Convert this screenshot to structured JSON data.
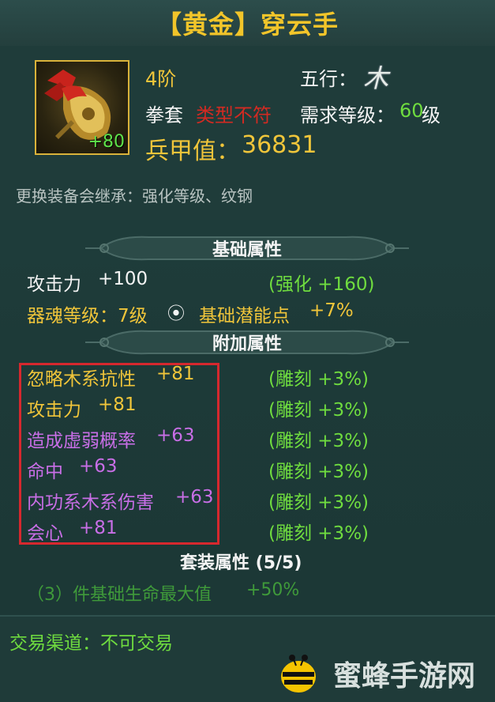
{
  "title": "【黄金】穿云手",
  "item": {
    "enhance_badge": "+80",
    "tier": "4阶",
    "five_element_label": "五行：",
    "five_element_glyph": "木",
    "type": "拳套",
    "type_mismatch": "类型不符",
    "level_label": "需求等级：",
    "level_value": "60",
    "level_unit": "级",
    "power_label": "兵甲值：",
    "power_value": "36831"
  },
  "inherit_note": "更换装备会继承：强化等级、纹钢",
  "sections": {
    "base": {
      "header": "基础属性",
      "attack_name": "攻击力",
      "attack_value": "+100",
      "attack_bonus": "(强化 +160)",
      "soul_level": "器魂等级：7级",
      "potential_label": "基础潜能点",
      "potential_value": "+7%"
    },
    "extra": {
      "header": "附加属性",
      "rows": [
        {
          "name": "忽略木系抗性",
          "value": "+81",
          "note": "(雕刻 +3%)"
        },
        {
          "name": "攻击力",
          "value": "+81",
          "note": "(雕刻 +3%)"
        },
        {
          "name": "造成虚弱概率",
          "value": "+63",
          "note": "(雕刻 +3%)"
        },
        {
          "name": "命中",
          "value": "+63",
          "note": "(雕刻 +3%)"
        },
        {
          "name": "内功系木系伤害",
          "value": "+63",
          "note": "(雕刻 +3%)"
        },
        {
          "name": "会心",
          "value": "+81",
          "note": "(雕刻 +3%)"
        }
      ]
    },
    "set": {
      "header": "套装属性 (5/5)",
      "bonus": "（3）件基础生命最大值",
      "bonus_value": "+50%"
    }
  },
  "trade": "交易渠道：不可交易",
  "watermark": "蜜蜂手游网",
  "colors": {
    "title": "#f2c52a",
    "green": "#6fdc3f",
    "purple": "#c86ee6",
    "highlight_box": "#d6282e"
  }
}
